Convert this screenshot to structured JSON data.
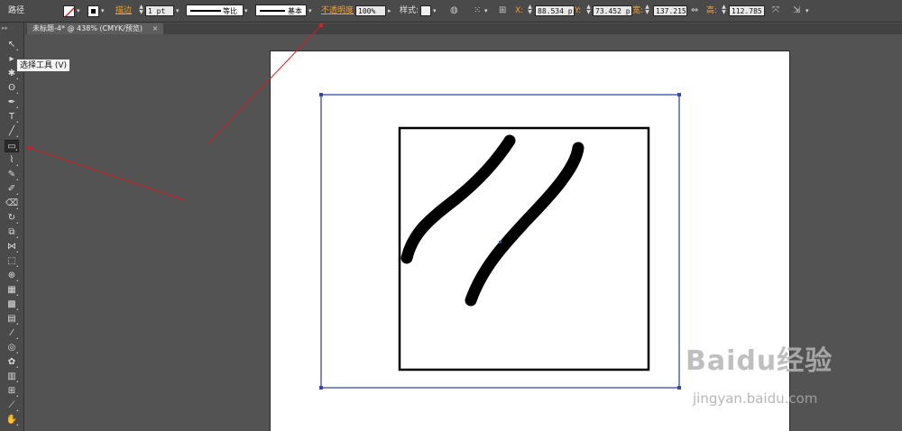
{
  "control_bar": {
    "object_type": "路径",
    "fill_icon": "none-slash-swatch",
    "stroke_label": "描边",
    "stroke_weight": "1 pt",
    "profile_label": "等比",
    "brush_label": "基本",
    "opacity_label": "不透明度",
    "opacity_value": "100%",
    "style_label": "样式:",
    "x_label": "X:",
    "x_value": "88.534 p",
    "y_label": "Y:",
    "y_value": "73.452 p",
    "width_label": "宽:",
    "width_value": "137.215",
    "height_label": "高:",
    "height_value": "112.785"
  },
  "document_tab": {
    "title": "未标题-4* @ 438% (CMYK/预览)",
    "close": "×"
  },
  "tools": [
    {
      "name": "selection-tool",
      "glyph": "↖"
    },
    {
      "name": "direct-selection-tool",
      "glyph": "▸"
    },
    {
      "name": "magic-wand-tool",
      "glyph": "✱"
    },
    {
      "name": "lasso-tool",
      "glyph": "ʘ"
    },
    {
      "name": "pen-tool",
      "glyph": "✒"
    },
    {
      "name": "type-tool",
      "glyph": "T"
    },
    {
      "name": "line-tool",
      "glyph": "╱"
    },
    {
      "name": "rectangle-tool",
      "glyph": "▭"
    },
    {
      "name": "paintbrush-tool",
      "glyph": "⌇"
    },
    {
      "name": "pencil-tool",
      "glyph": "✎"
    },
    {
      "name": "blob-brush-tool",
      "glyph": "✐"
    },
    {
      "name": "eraser-tool",
      "glyph": "⌫"
    },
    {
      "name": "rotate-tool",
      "glyph": "↻"
    },
    {
      "name": "scale-tool",
      "glyph": "⧉"
    },
    {
      "name": "width-tool",
      "glyph": "⋈"
    },
    {
      "name": "free-transform-tool",
      "glyph": "⬚"
    },
    {
      "name": "shape-builder-tool",
      "glyph": "⊕"
    },
    {
      "name": "perspective-grid-tool",
      "glyph": "▦"
    },
    {
      "name": "mesh-tool",
      "glyph": "▩"
    },
    {
      "name": "gradient-tool",
      "glyph": "▤"
    },
    {
      "name": "eyedropper-tool",
      "glyph": "⁄"
    },
    {
      "name": "blend-tool",
      "glyph": "◎"
    },
    {
      "name": "symbol-sprayer-tool",
      "glyph": "✿"
    },
    {
      "name": "column-graph-tool",
      "glyph": "▥"
    },
    {
      "name": "artboard-tool",
      "glyph": "⊞"
    },
    {
      "name": "slice-tool",
      "glyph": "⟋"
    },
    {
      "name": "hand-tool",
      "glyph": "✋"
    }
  ],
  "tooltip": "选择工具 (V)",
  "colors": {
    "annotation_arrow": "#cc2222",
    "selection_bbox": "#3a4a9a",
    "ui_bg": "#535353"
  },
  "watermark": {
    "logo": "Baidu经验",
    "url": "jingyan.baidu.com"
  }
}
